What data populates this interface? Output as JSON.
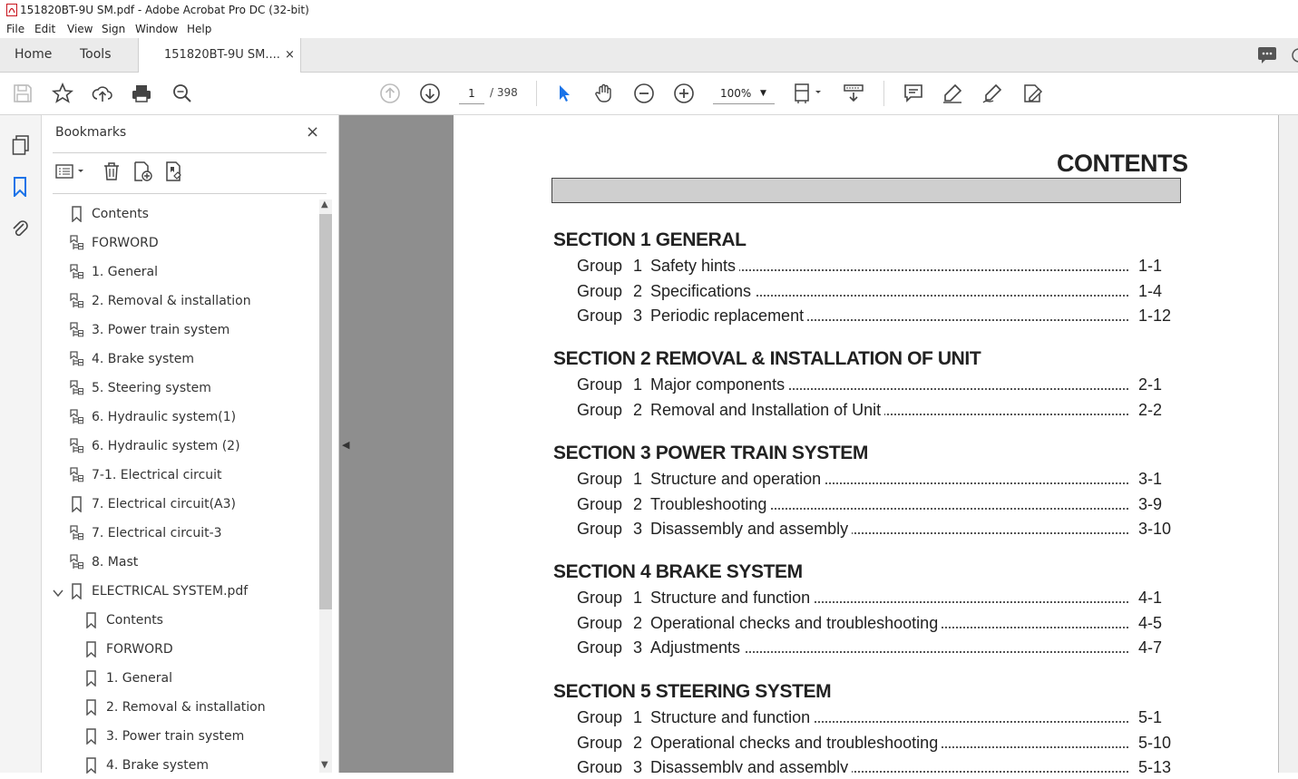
{
  "window": {
    "title": "151820BT-9U SM.pdf - Adobe Acrobat Pro DC (32-bit)",
    "accent": "#c8141e"
  },
  "menu": [
    "File",
    "Edit",
    "View",
    "Sign",
    "Window",
    "Help"
  ],
  "tabs": {
    "home": "Home",
    "tools": "Tools",
    "doc": "151820BT-9U SM....",
    "close": "×"
  },
  "toolbar": {
    "page_current": "1",
    "page_total": "/ 398",
    "zoom": "100%",
    "pointer_color": "#1a73e8",
    "icons": [
      "save-icon",
      "star-icon",
      "upload-icon",
      "print-icon",
      "search-zoom-icon",
      "prev-page-icon",
      "next-page-icon",
      "select-pointer-icon",
      "hand-icon",
      "zoom-out-icon",
      "zoom-in-icon",
      "fit-page-icon",
      "scroll-mode-icon",
      "comment-icon",
      "highlight-icon",
      "sign-icon",
      "edit-pdf-icon"
    ]
  },
  "leftrail": {
    "icons": [
      "pages-icon",
      "bookmark-icon",
      "attachment-icon"
    ]
  },
  "bookmarks": {
    "title": "Bookmarks",
    "close": "×",
    "items": [
      {
        "label": "Contents",
        "icon": "bookmark-icon"
      },
      {
        "label": "FORWORD",
        "icon": "bookmark-tree-icon"
      },
      {
        "label": "1. General",
        "icon": "bookmark-tree-icon"
      },
      {
        "label": "2. Removal & installation",
        "icon": "bookmark-tree-icon"
      },
      {
        "label": "3. Power train system",
        "icon": "bookmark-tree-icon"
      },
      {
        "label": "4. Brake system",
        "icon": "bookmark-tree-icon"
      },
      {
        "label": "5. Steering system",
        "icon": "bookmark-tree-icon"
      },
      {
        "label": "6. Hydraulic system(1)",
        "icon": "bookmark-tree-icon"
      },
      {
        "label": "6. Hydraulic system (2)",
        "icon": "bookmark-tree-icon"
      },
      {
        "label": "7-1. Electrical circuit",
        "icon": "bookmark-tree-icon"
      },
      {
        "label": "7. Electrical circuit(A3)",
        "icon": "bookmark-icon"
      },
      {
        "label": "7. Electrical circuit-3",
        "icon": "bookmark-tree-icon"
      },
      {
        "label": "8. Mast",
        "icon": "bookmark-tree-icon"
      },
      {
        "label": "ELECTRICAL SYSTEM.pdf",
        "icon": "bookmark-icon"
      },
      {
        "label": "Contents",
        "icon": "bookmark-icon"
      },
      {
        "label": "FORWORD",
        "icon": "bookmark-icon"
      },
      {
        "label": "1. General",
        "icon": "bookmark-icon"
      },
      {
        "label": "2. Removal & installation",
        "icon": "bookmark-icon"
      },
      {
        "label": "3. Power train system",
        "icon": "bookmark-icon"
      },
      {
        "label": "4. Brake system",
        "icon": "bookmark-icon"
      }
    ]
  },
  "document": {
    "title": "CONTENTS",
    "group_word": "Group",
    "sections": [
      {
        "heading": "SECTION 1  GENERAL",
        "groups": [
          {
            "n": "1",
            "title": "Safety hints",
            "page": "1-1"
          },
          {
            "n": "2",
            "title": "Specifications",
            "page": "1-4"
          },
          {
            "n": "3",
            "title": "Periodic replacement",
            "page": "1-12"
          }
        ]
      },
      {
        "heading": "SECTION 2  REMOVAL & INSTALLATION OF UNIT",
        "groups": [
          {
            "n": "1",
            "title": "Major components",
            "page": "2-1"
          },
          {
            "n": "2",
            "title": "Removal and Installation of Unit",
            "page": "2-2"
          }
        ]
      },
      {
        "heading": "SECTION 3  POWER TRAIN SYSTEM",
        "groups": [
          {
            "n": "1",
            "title": "Structure and operation",
            "page": "3-1"
          },
          {
            "n": "2",
            "title": "Troubleshooting",
            "page": "3-9"
          },
          {
            "n": "3",
            "title": "Disassembly and assembly",
            "page": "3-10"
          }
        ]
      },
      {
        "heading": "SECTION 4  BRAKE SYSTEM",
        "groups": [
          {
            "n": "1",
            "title": "Structure and function",
            "page": "4-1"
          },
          {
            "n": "2",
            "title": "Operational checks and troubleshooting",
            "page": "4-5"
          },
          {
            "n": "3",
            "title": "Adjustments",
            "page": "4-7"
          }
        ]
      },
      {
        "heading": "SECTION 5  STEERING SYSTEM",
        "groups": [
          {
            "n": "1",
            "title": "Structure and function",
            "page": "5-1"
          },
          {
            "n": "2",
            "title": "Operational checks and troubleshooting",
            "page": "5-10"
          },
          {
            "n": "3",
            "title": "Disassembly and assembly",
            "page": "5-13"
          }
        ]
      }
    ]
  }
}
